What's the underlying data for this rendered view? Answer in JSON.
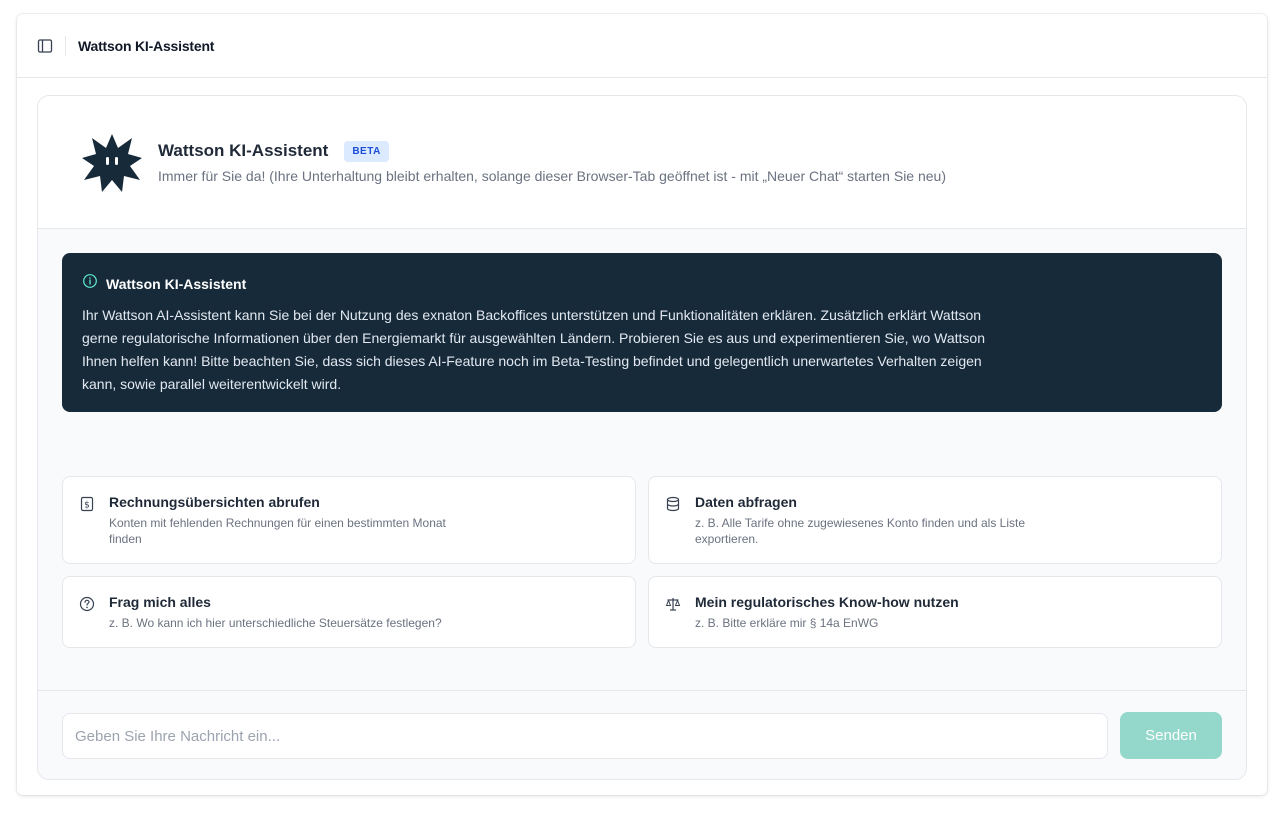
{
  "topbar": {
    "title": "Wattson KI-Assistent",
    "sidebar_icon": "sidebar-toggle-icon"
  },
  "header": {
    "title": "Wattson KI-Assistent",
    "badge": "BETA",
    "subtitle": "Immer für Sie da! (Ihre Unterhaltung bleibt erhalten, solange dieser Browser-Tab geöffnet ist - mit „Neuer Chat“ starten Sie neu)",
    "logo_icon": "wattson-mascot-icon"
  },
  "info": {
    "icon": "info-icon",
    "title": "Wattson KI-Assistent",
    "text": "Ihr Wattson AI-Assistent kann Sie bei der Nutzung des exnaton Backoffices unterstützen und Funktionalitäten erklären. Zusätzlich erklärt Wattson gerne regulatorische Informationen über den Energiemarkt für ausgewählten Ländern. Probieren Sie es aus und experimentieren Sie, wo Wattson Ihnen helfen kann! Bitte beachten Sie, dass sich dieses AI-Feature noch im Beta-Testing befindet und gelegentlich unerwartetes Verhalten zeigen kann, sowie parallel weiterentwickelt wird."
  },
  "suggestions": [
    {
      "icon": "invoice-icon",
      "title": "Rechnungsübersichten abrufen",
      "desc": "Konten mit fehlenden Rechnungen für einen bestimmten Monat finden"
    },
    {
      "icon": "database-icon",
      "title": "Daten abfragen",
      "desc": "z. B. Alle Tarife ohne zugewiesenes Konto finden und als Liste exportieren."
    },
    {
      "icon": "question-icon",
      "title": "Frag mich alles",
      "desc": "z. B. Wo kann ich hier unterschiedliche Steuersätze festlegen?"
    },
    {
      "icon": "scales-icon",
      "title": "Mein regulatorisches Know-how nutzen",
      "desc": "z. B. Bitte erkläre mir § 14a EnWG"
    }
  ],
  "composer": {
    "placeholder": "Geben Sie Ihre Nachricht ein...",
    "value": "",
    "send_label": "Senden"
  },
  "colors": {
    "info_background": "#172a3a",
    "accent_teal": "#93d8cb",
    "badge_background": "#dbeafe",
    "badge_text": "#1d4ed8"
  }
}
